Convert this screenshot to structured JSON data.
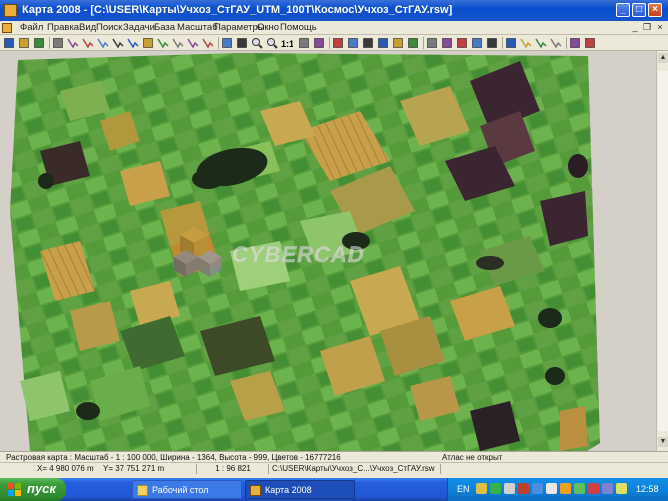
{
  "window": {
    "title": "Карта 2008 - [C:\\USER\\Карты\\Учхоз_СтГАУ_UTM_100T\\Космос\\Учхоз_СтГАУ.rsw]",
    "minimize_icon": "minimize-icon",
    "maximize_icon": "maximize-icon",
    "close_icon": "close-icon"
  },
  "menu": {
    "items": [
      "Файл",
      "Правка",
      "Вид",
      "Поиск",
      "Задачи",
      "База",
      "Масштаб",
      "Параметры",
      "Окно",
      "Помощь"
    ]
  },
  "toolbar": {
    "icons": [
      "new-icon",
      "open-icon",
      "save-icon",
      "layers-icon",
      "select-icon",
      "select-icon",
      "select-icon",
      "select-icon",
      "select-icon",
      "rect-icon",
      "select-icon",
      "select-icon",
      "select-icon",
      "select-icon",
      "info-icon",
      "nav-icon",
      "zoom-in-icon",
      "zoom-out-icon",
      "scale-1-1-icon",
      "fit-icon",
      "pan-icon",
      "arrow-icon",
      "text-icon",
      "fill-icon",
      "shape-icon",
      "globe-icon",
      "palette-icon",
      "print-icon",
      "edit-icon",
      "book-icon",
      "help-icon",
      "pin-icon",
      "cursor-icon",
      "route-icon",
      "route-icon",
      "route-icon",
      "undo-icon",
      "close-doc-icon"
    ],
    "zoom_label": "1:1"
  },
  "map": {
    "watermark": "CYBERCAD",
    "colors": {
      "field_green": "#4f9a3a",
      "light_green": "#8ed46a",
      "olive": "#8a8a3a",
      "wheat": "#c8a04a",
      "dark": "#2a2a26",
      "purple": "#3a2030",
      "water": "#1a2a1a"
    }
  },
  "status_top": {
    "map_info": "Растровая карта : Масштаб - 1 : 100 000, Ширина - 1364, Высота - 999, Цветов - 16777216",
    "atlas": "Атлас не открыт"
  },
  "status_bottom": {
    "x": "X= 4 980 076 m",
    "y": "Y= 37 751 271 m",
    "scale": "1 : 96 821",
    "path": "C:\\USER\\Карты\\Учхоз_С...\\Учхоз_СтГАУ.rsw"
  },
  "taskbar": {
    "start_label": "пуск",
    "tasks": [
      {
        "label": "Рабочий стол",
        "icon": "folder-icon"
      },
      {
        "label": "Карта 2008",
        "icon": "app-icon"
      }
    ],
    "lang": "EN",
    "clock": "12:58"
  }
}
